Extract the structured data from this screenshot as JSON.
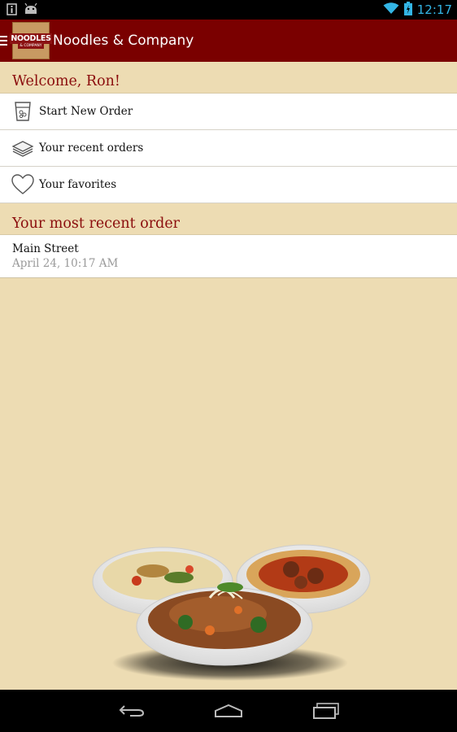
{
  "status_bar": {
    "time": "12:17",
    "left_icons": [
      "notification-icon",
      "android-icon"
    ],
    "right_icons": [
      "wifi-icon",
      "battery-icon"
    ]
  },
  "action_bar": {
    "title": "Noodles & Company",
    "logo_text_main": "NOODLES",
    "logo_text_sub": "& COMPANY",
    "background_color": "#7a0000"
  },
  "welcome": {
    "heading": "Welcome, Ron!"
  },
  "menu": {
    "items": [
      {
        "label": "Start New Order",
        "icon": "cup-icon"
      },
      {
        "label": "Your recent orders",
        "icon": "stack-icon"
      },
      {
        "label": "Your favorites",
        "icon": "heart-icon"
      }
    ]
  },
  "recent_order": {
    "heading": "Your most recent order",
    "location": "Main Street",
    "datetime": "April 24, 10:17 AM"
  },
  "nav_bar": {
    "buttons": [
      "back-icon",
      "home-icon",
      "recent-apps-icon"
    ]
  },
  "colors": {
    "accent": "#8b0d0d",
    "background": "#eddcb3",
    "status_time": "#33b5e5"
  }
}
